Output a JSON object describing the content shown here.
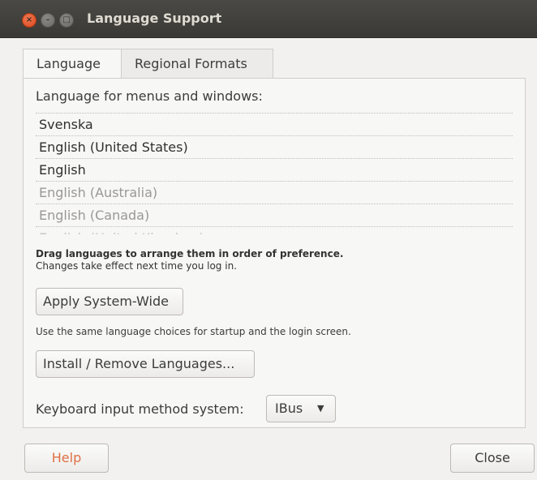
{
  "window": {
    "title": "Language Support",
    "controls": {
      "close_glyph": "×",
      "minimize_glyph": "–",
      "maximize_glyph": "□"
    }
  },
  "tabs": [
    {
      "label": "Language",
      "active": true
    },
    {
      "label": "Regional Formats",
      "active": false
    }
  ],
  "language_tab": {
    "list_label": "Language for menus and windows:",
    "languages": [
      "Svenska",
      "English (United States)",
      "English",
      "English (Australia)",
      "English (Canada)",
      "English (United Kingdom)"
    ],
    "drag_hint_bold": "Drag languages to arrange them in order of preference.",
    "drag_hint_sub": "Changes take effect next time you log in.",
    "apply_button": "Apply System-Wide",
    "apply_description": "Use the same language choices for startup and the login screen.",
    "install_button": "Install / Remove Languages...",
    "keyboard_label": "Keyboard input method system:",
    "keyboard_value": "IBus",
    "keyboard_arrow": "▼"
  },
  "footer": {
    "help_button": "Help",
    "close_button": "Close"
  },
  "colors": {
    "titlebar": "#3c3b37",
    "window_bg": "#f2f1f0",
    "accent_help": "#e06f44",
    "close_button_orange": "#e0562b"
  }
}
